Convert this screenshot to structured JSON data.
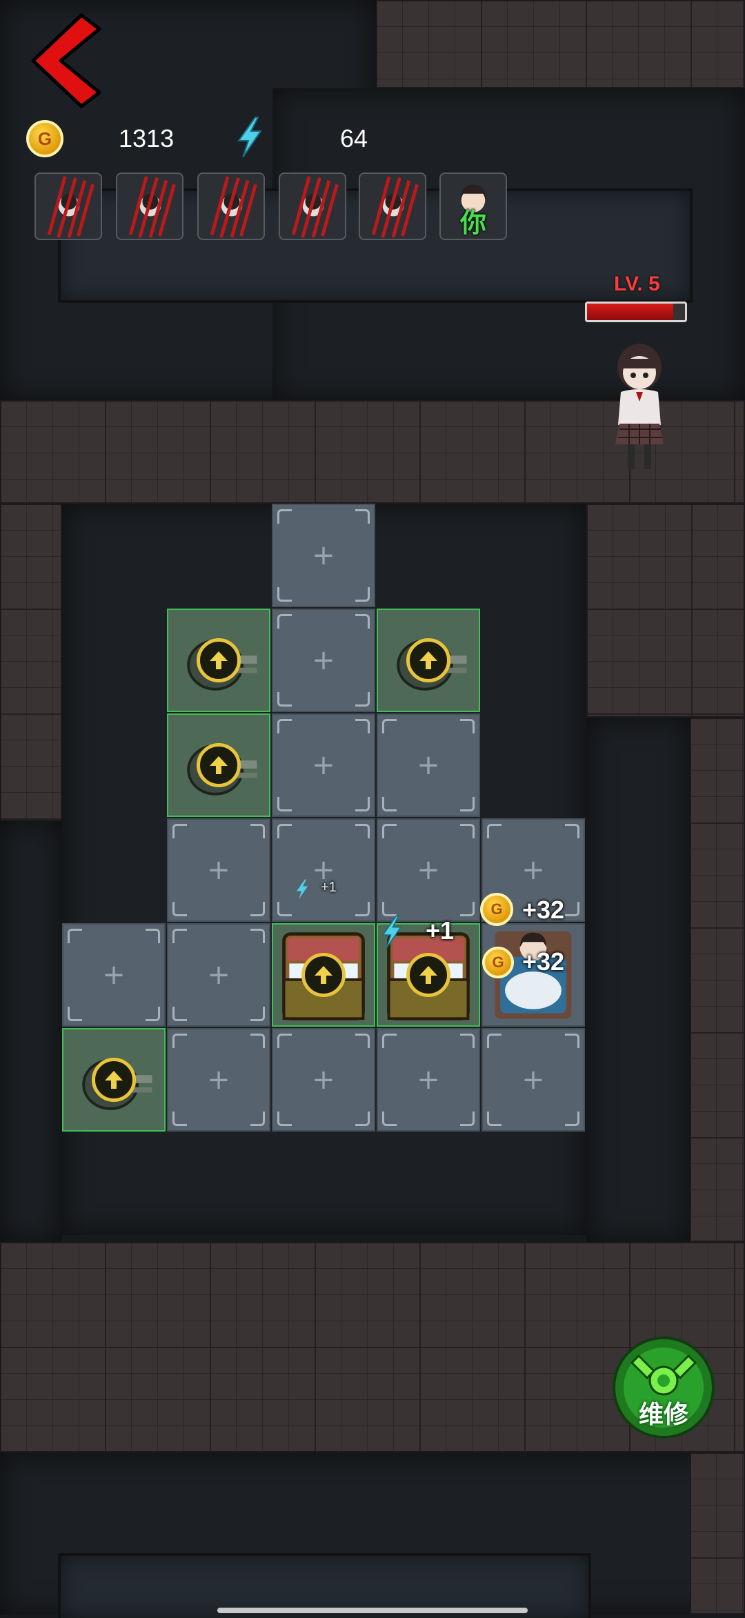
{
  "hud": {
    "gold": "1313",
    "energy": "64",
    "coin_symbol": "G"
  },
  "party": {
    "you_label": "你",
    "slots": [
      "clawed-ghost",
      "clawed-ghost",
      "clawed-ghost",
      "clawed-ghost",
      "clawed-ghost",
      "you"
    ]
  },
  "enemy": {
    "level": "LV. 5",
    "hp_fraction": 0.88
  },
  "floats": {
    "energy_big": "+1",
    "energy_small": "+1",
    "gold_1": "+32",
    "gold_2": "+32"
  },
  "grid": {
    "plus": "+"
  },
  "repair": {
    "label": "维修"
  },
  "colors": {
    "accent_green": "#3fbf55",
    "danger_red": "#d81b1b",
    "gold": "#e9c43a"
  }
}
